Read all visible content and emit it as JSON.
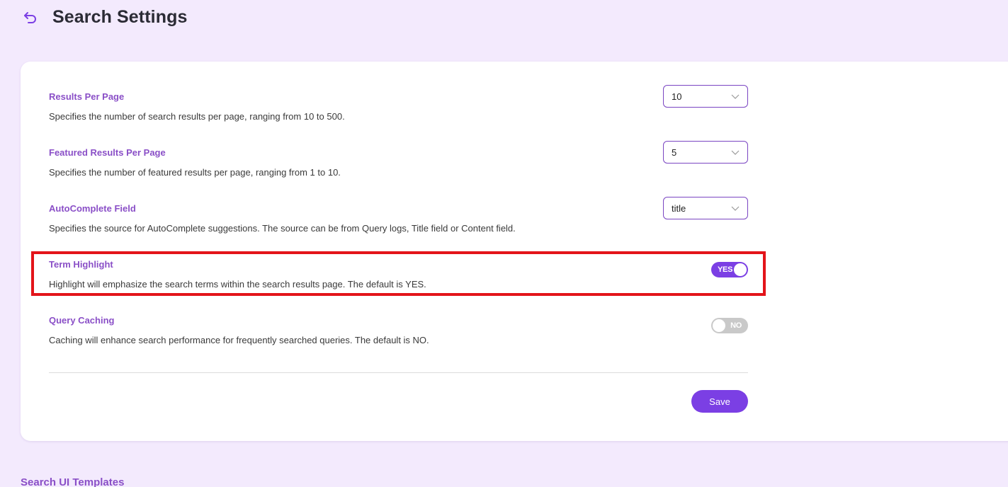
{
  "header": {
    "title": "Search Settings",
    "back_icon": "undo-arrow-icon"
  },
  "settings": {
    "results_per_page": {
      "label": "Results Per Page",
      "description": "Specifies the number of search results per page, ranging from 10 to 500.",
      "value": "10"
    },
    "featured_results_per_page": {
      "label": "Featured Results Per Page",
      "description": "Specifies the number of featured results per page, ranging from 1 to 10.",
      "value": "5"
    },
    "autocomplete_field": {
      "label": "AutoComplete Field",
      "description": "Specifies the source for AutoComplete suggestions. The source can be from Query logs, Title field or Content field.",
      "value": "title"
    },
    "term_highlight": {
      "label": "Term Highlight",
      "description": "Highlight will emphasize the search terms within the search results page. The default is YES.",
      "toggle_label": "YES",
      "enabled": true
    },
    "query_caching": {
      "label": "Query Caching",
      "description": "Caching will enhance search performance for frequently searched queries. The default is NO.",
      "toggle_label": "NO",
      "enabled": false
    }
  },
  "actions": {
    "save_label": "Save"
  },
  "next_section": {
    "title": "Search UI Templates"
  },
  "colors": {
    "page_bg": "#f3eafd",
    "accent": "#7b3fe4",
    "label": "#8a4fc7",
    "highlight_border": "#e3141a"
  }
}
